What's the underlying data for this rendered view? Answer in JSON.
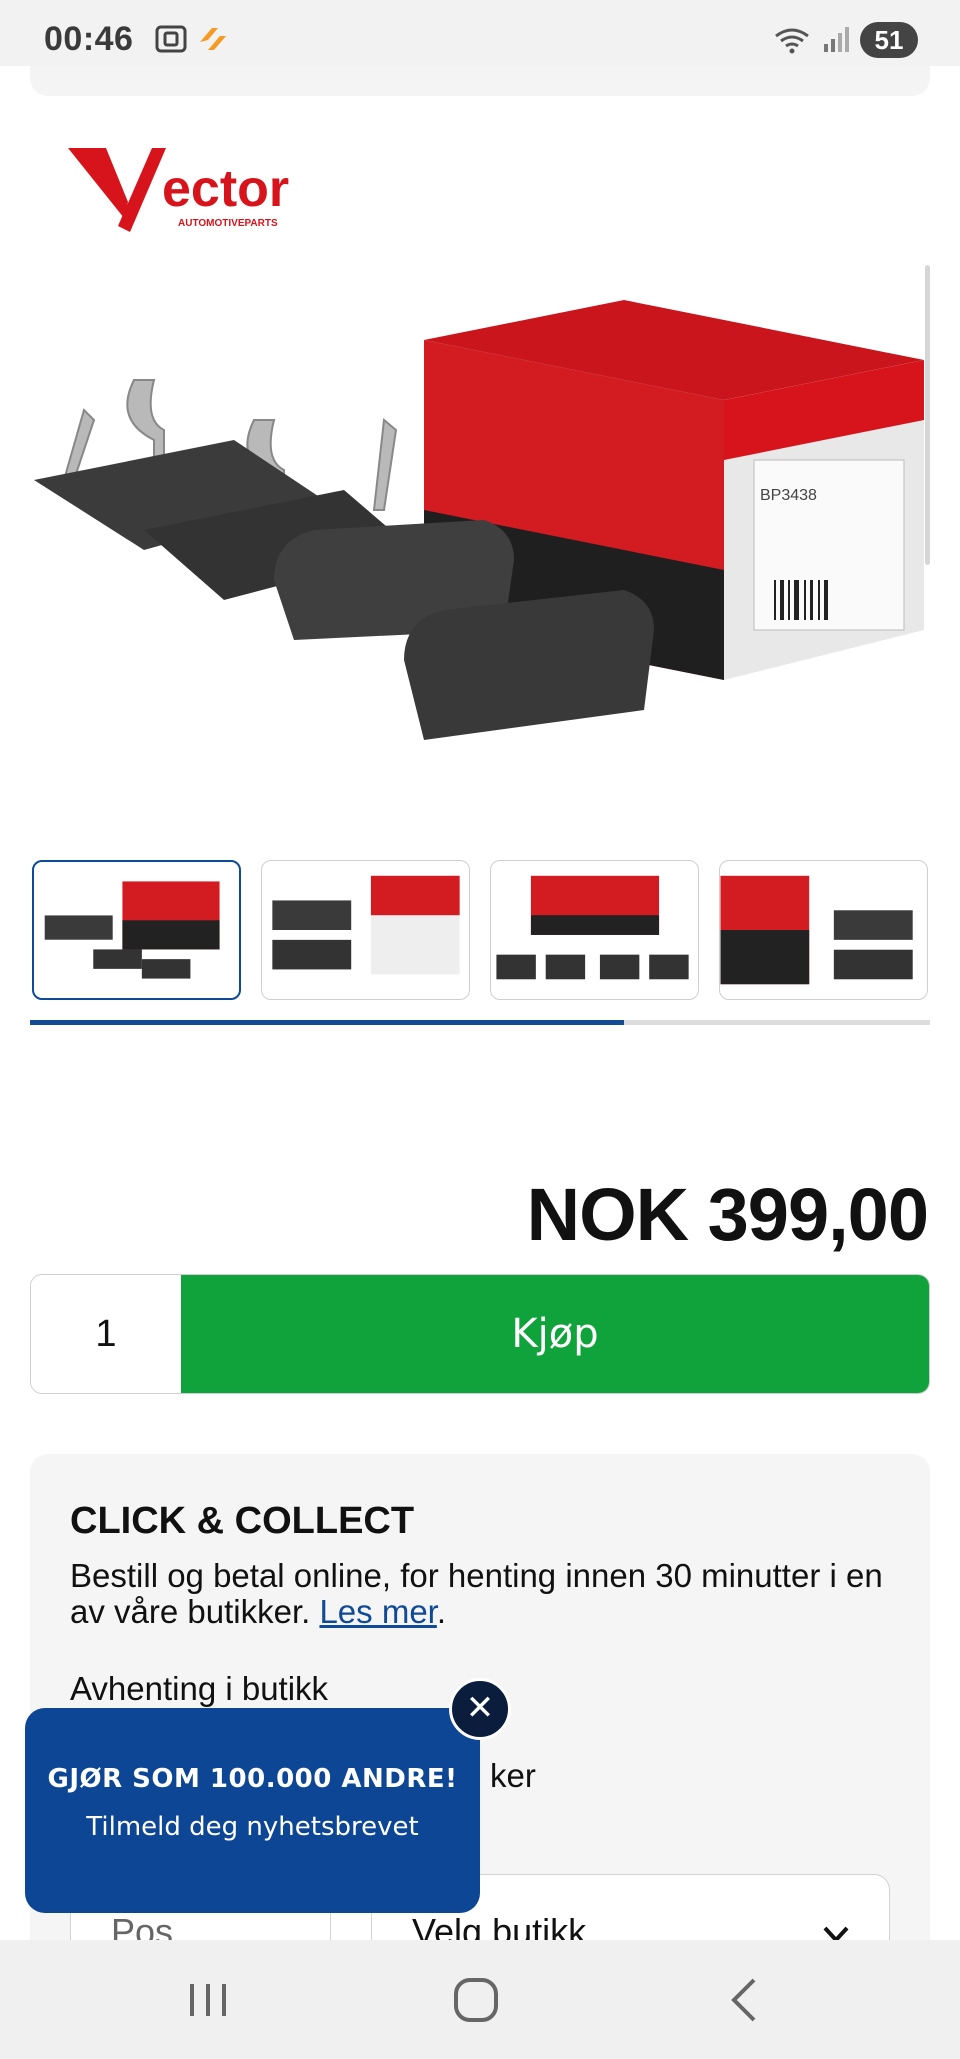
{
  "status_bar": {
    "time": "00:46",
    "battery": "51",
    "icons": [
      "screenshot-icon",
      "flash-app-icon",
      "wifi-icon",
      "signal-icon"
    ]
  },
  "gallery": {
    "logo_word": "Vector",
    "logo_tagline": "AUTOMOTIVEPARTS",
    "box_code": "BP3438",
    "thumbnail_count": 4,
    "active_thumbnail": 1,
    "progress_fraction": 0.66
  },
  "product": {
    "price": "NOK 399,00",
    "quantity": "1",
    "buy_label": "Kjøp"
  },
  "click_collect": {
    "title": "CLICK & COLLECT",
    "text": "Bestill og betal online, for henting innen 30 minutter i en av våre butikker.",
    "link_label": "Les mer",
    "link_suffix": ".",
    "pickup_label": "Avhenting i butikk",
    "partial_label": "ker",
    "pos_placeholder": "Pos",
    "store_select": "Velg butikk"
  },
  "newsletter": {
    "title": "GJØR SOM 100.000 ANDRE!",
    "subtitle": "Tilmeld deg nyhetsbrevet",
    "close_symbol": "✕"
  },
  "colors": {
    "buy_green": "#10a33c",
    "brand_blue": "#0d4695",
    "logo_red": "#d7141b"
  }
}
